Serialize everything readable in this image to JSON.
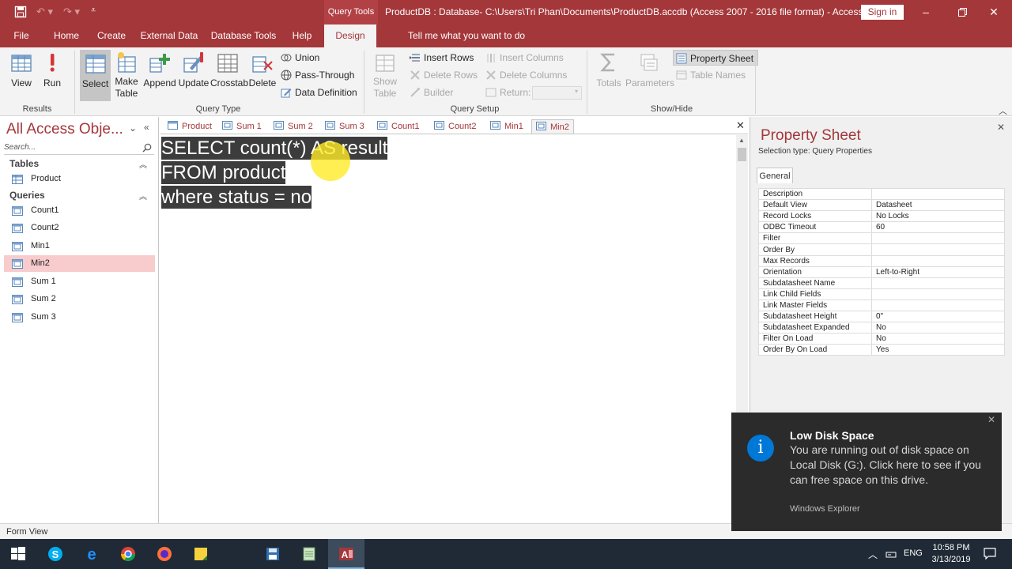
{
  "titlebar": {
    "context_tab": "Query Tools",
    "title": "ProductDB : Database- C:\\Users\\Tri Phan\\Documents\\ProductDB.accdb (Access 2007 - 2016 file format)  -  Access",
    "sign_in": "Sign in"
  },
  "ribbon_tabs": {
    "file": "File",
    "home": "Home",
    "create": "Create",
    "external_data": "External Data",
    "database_tools": "Database Tools",
    "help": "Help",
    "design": "Design",
    "tell_me": "Tell me what you want to do"
  },
  "ribbon": {
    "results": {
      "view": "View",
      "run": "Run",
      "label": "Results"
    },
    "query_type": {
      "select": "Select",
      "make_table_1": "Make",
      "make_table_2": "Table",
      "append": "Append",
      "update": "Update",
      "crosstab": "Crosstab",
      "delete": "Delete",
      "union": "Union",
      "pass_through": "Pass-Through",
      "data_definition": "Data Definition",
      "label": "Query Type"
    },
    "query_setup": {
      "show_table_1": "Show",
      "show_table_2": "Table",
      "insert_rows": "Insert Rows",
      "delete_rows": "Delete Rows",
      "builder": "Builder",
      "insert_columns": "Insert Columns",
      "delete_columns": "Delete Columns",
      "return": "Return:",
      "label": "Query Setup"
    },
    "show_hide": {
      "totals": "Totals",
      "parameters": "Parameters",
      "property_sheet": "Property Sheet",
      "table_names": "Table Names",
      "label": "Show/Hide"
    }
  },
  "nav": {
    "title": "All Access Obje...",
    "search_placeholder": "Search...",
    "tables_header": "Tables",
    "tables": [
      "Product"
    ],
    "queries_header": "Queries",
    "queries": [
      "Count1",
      "Count2",
      "Min1",
      "Min2",
      "Sum 1",
      "Sum 2",
      "Sum 3"
    ],
    "selected": "Min2"
  },
  "doc_tabs": [
    "Product",
    "Sum 1",
    "Sum 2",
    "Sum 3",
    "Count1",
    "Count2",
    "Min1",
    "Min2"
  ],
  "active_doc_tab": "Min2",
  "sql": {
    "line1": "SELECT count(*) AS result",
    "line2": "FROM product",
    "line3": "where status = no"
  },
  "property_sheet": {
    "title": "Property Sheet",
    "selection_type": "Selection type:  Query Properties",
    "tab": "General",
    "rows": [
      {
        "k": "Description",
        "v": ""
      },
      {
        "k": "Default View",
        "v": "Datasheet"
      },
      {
        "k": "Record Locks",
        "v": "No Locks"
      },
      {
        "k": "ODBC Timeout",
        "v": "60"
      },
      {
        "k": "Filter",
        "v": ""
      },
      {
        "k": "Order By",
        "v": ""
      },
      {
        "k": "Max Records",
        "v": ""
      },
      {
        "k": "Orientation",
        "v": "Left-to-Right"
      },
      {
        "k": "Subdatasheet Name",
        "v": ""
      },
      {
        "k": "Link Child Fields",
        "v": ""
      },
      {
        "k": "Link Master Fields",
        "v": ""
      },
      {
        "k": "Subdatasheet Height",
        "v": "0\""
      },
      {
        "k": "Subdatasheet Expanded",
        "v": "No"
      },
      {
        "k": "Filter On Load",
        "v": "No"
      },
      {
        "k": "Order By On Load",
        "v": "Yes"
      }
    ]
  },
  "status": {
    "text": "Form View"
  },
  "toast": {
    "title": "Low Disk Space",
    "body": "You are running out of disk space on Local Disk (G:). Click here to see if you can free space on this drive.",
    "source": "Windows Explorer"
  },
  "taskbar": {
    "lang": "ENG",
    "time": "10:58 PM",
    "date": "3/13/2019"
  },
  "colors": {
    "accent": "#a4373a",
    "selection": "#f8cbcd",
    "toast_icon": "#0078d7"
  }
}
